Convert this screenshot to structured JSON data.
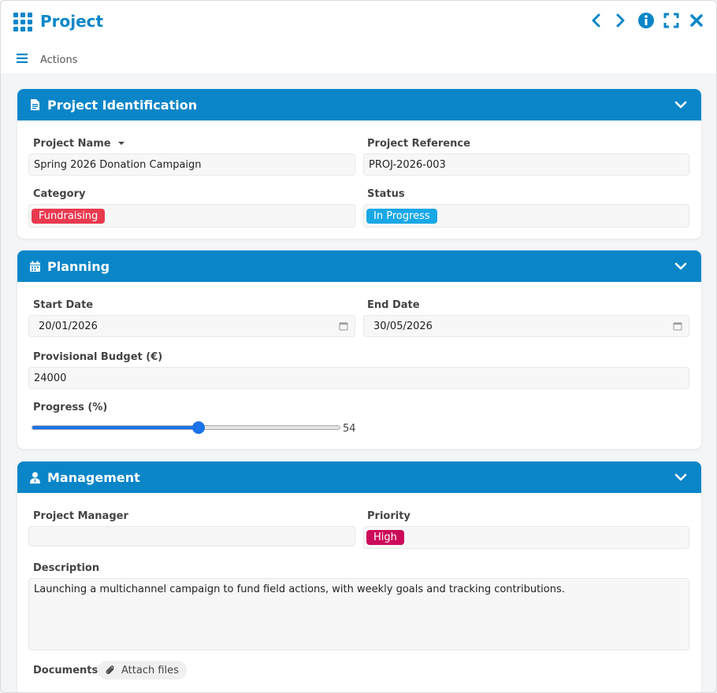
{
  "window": {
    "title": "Project"
  },
  "toolbar": {
    "actions_label": "Actions"
  },
  "colors": {
    "accent": "#0a86c8",
    "tag_fundraising": "#e8394f",
    "tag_in_progress": "#19a8e6",
    "tag_high": "#cc0a5a",
    "slider": "#1a73e8"
  },
  "icons": {
    "app": "grid-icon",
    "prev": "chevron-left-icon",
    "next": "chevron-right-icon",
    "info": "info-icon",
    "fullscreen": "expand-icon",
    "close": "close-icon",
    "menu": "hamburger-icon"
  },
  "sections": {
    "identification": {
      "title": "Project Identification",
      "project_name_label": "Project Name",
      "project_name_value": "Spring 2026 Donation Campaign",
      "project_reference_label": "Project Reference",
      "project_reference_value": "PROJ-2026-003",
      "category_label": "Category",
      "category_value": "Fundraising",
      "status_label": "Status",
      "status_value": "In Progress"
    },
    "planning": {
      "title": "Planning",
      "start_date_label": "Start Date",
      "start_date_value": "20/01/2026",
      "end_date_label": "End Date",
      "end_date_value": "30/05/2026",
      "budget_label": "Provisional Budget (€)",
      "budget_value": "24000",
      "progress_label": "Progress (%)",
      "progress_value": 54,
      "progress_display": "54"
    },
    "management": {
      "title": "Management",
      "manager_label": "Project Manager",
      "manager_value": "",
      "priority_label": "Priority",
      "priority_value": "High",
      "description_label": "Description",
      "description_value": "Launching a multichannel campaign to fund field actions, with weekly goals and tracking contributions.",
      "documents_label": "Documents",
      "attach_label": "Attach files"
    }
  }
}
